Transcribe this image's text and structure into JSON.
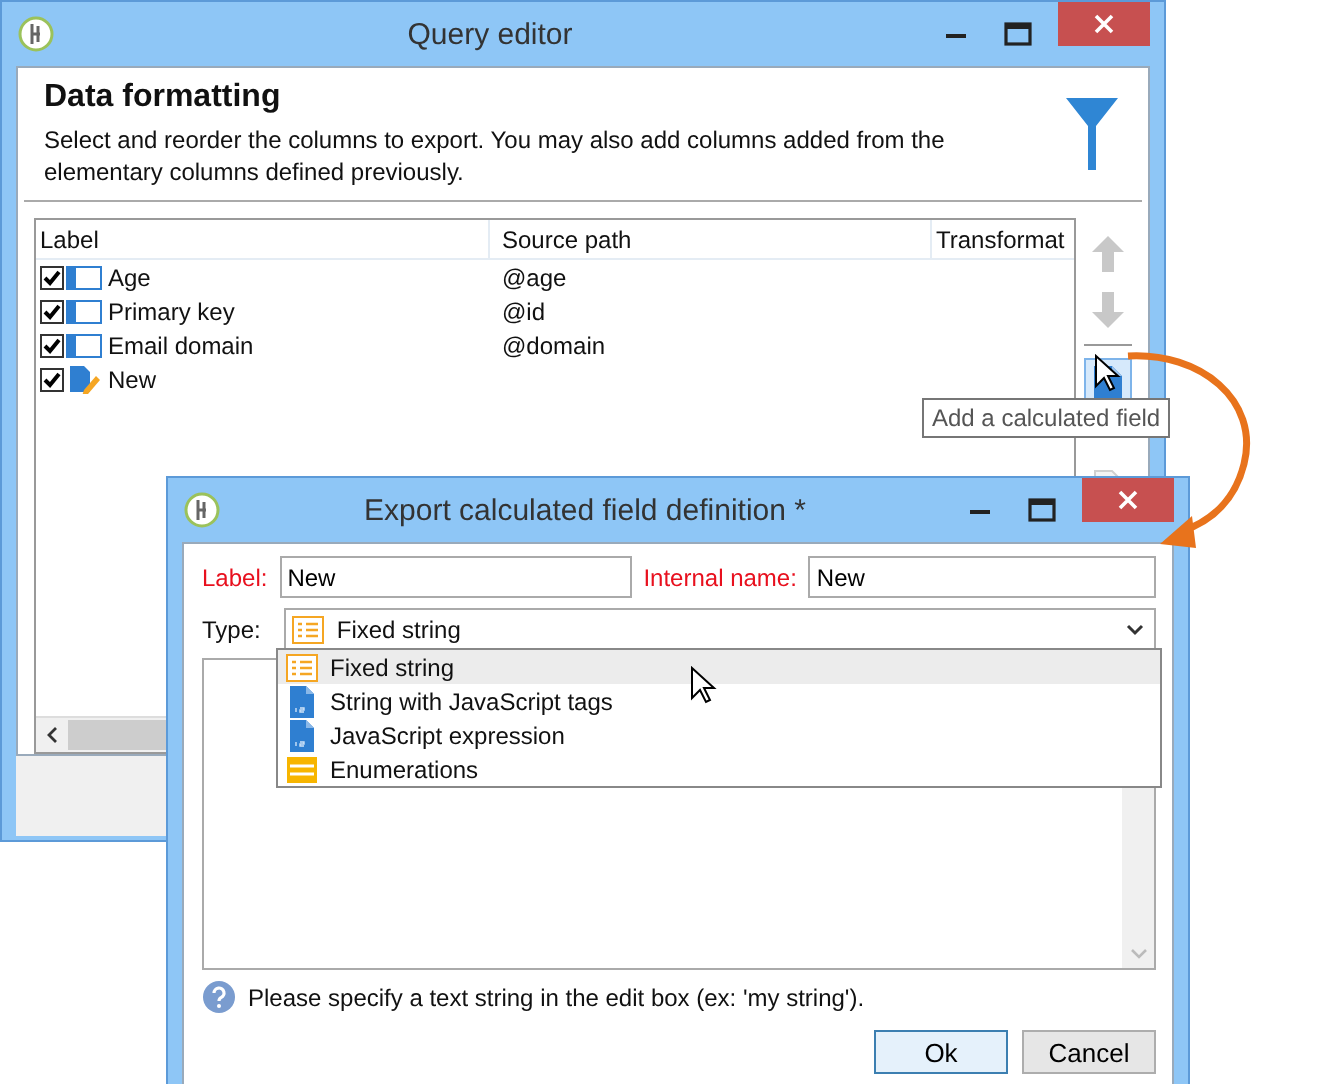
{
  "query_editor": {
    "title": "Query editor",
    "heading": "Data formatting",
    "description": "Select and reorder the columns to export. You may also add columns added from the elementary columns defined previously.",
    "columns": [
      "Label",
      "Source path",
      "Transformat"
    ],
    "rows": [
      {
        "checked": true,
        "kind": "column",
        "label": "Age",
        "source_path": "@age"
      },
      {
        "checked": true,
        "kind": "column",
        "label": "Primary key",
        "source_path": "@id"
      },
      {
        "checked": true,
        "kind": "column",
        "label": "Email domain",
        "source_path": "@domain"
      },
      {
        "checked": true,
        "kind": "calculated",
        "label": "New"
      }
    ],
    "tooltip": "Add a calculated field"
  },
  "field_dialog": {
    "title": "Export calculated field definition *",
    "label_caption": "Label:",
    "label_value": "New",
    "internal_name_caption": "Internal name:",
    "internal_name_value": "New",
    "type_caption": "Type:",
    "type_value": "Fixed string",
    "options": [
      {
        "label": "Fixed string",
        "kind": "list",
        "selected": true
      },
      {
        "label": "String with JavaScript tags",
        "kind": "script",
        "selected": false
      },
      {
        "label": "JavaScript expression",
        "kind": "script",
        "selected": false
      },
      {
        "label": "Enumerations",
        "kind": "enum",
        "selected": false
      }
    ],
    "help": "Please specify a text string in the edit box (ex: 'my string').",
    "buttons": [
      "Ok",
      "Cancel"
    ]
  }
}
